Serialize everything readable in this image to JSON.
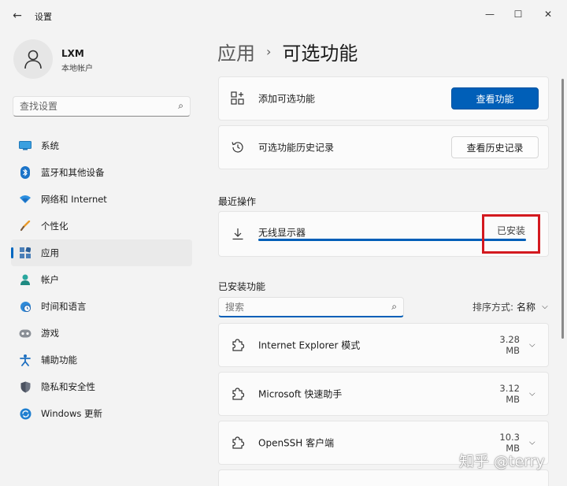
{
  "window": {
    "app_title": "设置",
    "back_glyph": "←",
    "minimize_glyph": "—",
    "maximize_glyph": "☐",
    "close_glyph": "✕"
  },
  "user": {
    "name": "LXM",
    "account_type": "本地帐户"
  },
  "search": {
    "placeholder": "查找设置"
  },
  "sidebar": {
    "items": [
      {
        "label": "系统",
        "icon": "monitor-icon"
      },
      {
        "label": "蓝牙和其他设备",
        "icon": "bluetooth-icon"
      },
      {
        "label": "网络和 Internet",
        "icon": "wifi-icon"
      },
      {
        "label": "个性化",
        "icon": "brush-icon"
      },
      {
        "label": "应用",
        "icon": "apps-icon",
        "selected": true
      },
      {
        "label": "帐户",
        "icon": "person-icon"
      },
      {
        "label": "时间和语言",
        "icon": "globe-clock-icon"
      },
      {
        "label": "游戏",
        "icon": "gamepad-icon"
      },
      {
        "label": "辅助功能",
        "icon": "accessibility-icon"
      },
      {
        "label": "隐私和安全性",
        "icon": "shield-icon"
      },
      {
        "label": "Windows 更新",
        "icon": "sync-icon"
      }
    ]
  },
  "breadcrumb": {
    "parent": "应用",
    "separator": "›",
    "current": "可选功能"
  },
  "add_feature": {
    "label": "添加可选功能",
    "button": "查看功能",
    "icon": "add-grid-icon"
  },
  "history": {
    "label": "可选功能历史记录",
    "button": "查看历史记录",
    "icon": "history-icon"
  },
  "recent": {
    "title": "最近操作",
    "item": {
      "name": "无线显示器",
      "status": "已安装",
      "progress": 1.0,
      "icon": "download-icon"
    }
  },
  "installed": {
    "title": "已安装功能",
    "filter_placeholder": "搜索",
    "sort_label": "排序方式:",
    "sort_value": "名称",
    "features": [
      {
        "name": "Internet Explorer 模式",
        "size": "3.28 MB",
        "icon": "puzzle-icon"
      },
      {
        "name": "Microsoft 快速助手",
        "size": "3.12 MB",
        "icon": "puzzle-icon"
      },
      {
        "name": "OpenSSH 客户端",
        "size": "10.3 MB",
        "icon": "puzzle-icon"
      }
    ]
  },
  "colors": {
    "accent": "#005fb8",
    "highlight": "#d3191f",
    "background": "#f3f3f3"
  },
  "watermark": "知乎 @terry"
}
